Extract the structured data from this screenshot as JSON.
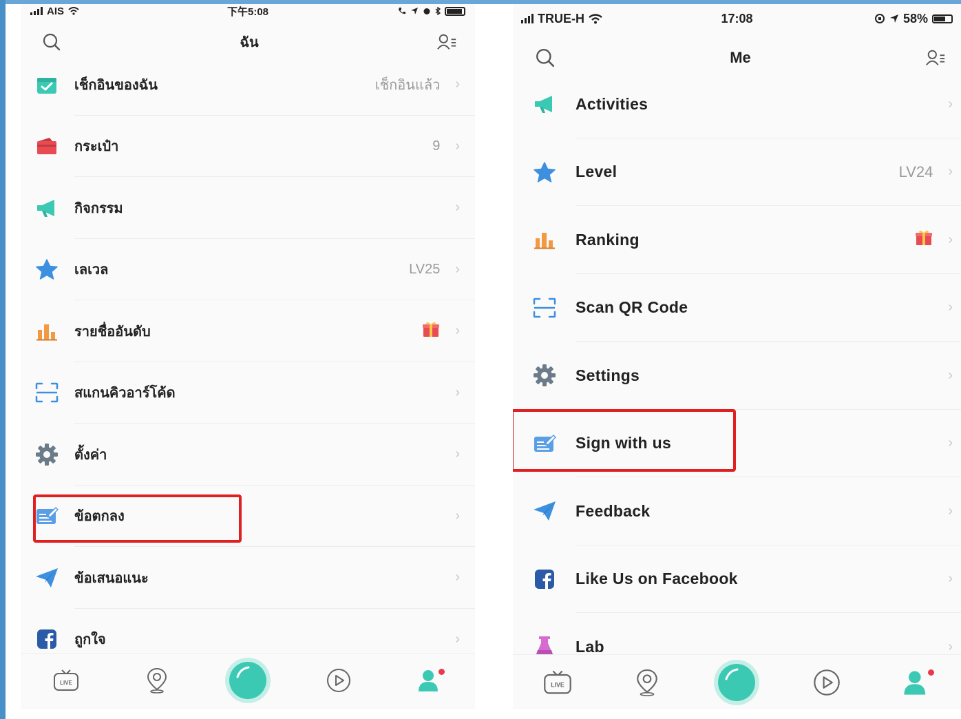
{
  "left_phone": {
    "status_bar": {
      "carrier": "AIS",
      "time": "下午5:08"
    },
    "title": "ฉัน",
    "menu": [
      {
        "label": "เช็กอินของฉัน",
        "value": "เช็กอินแล้ว",
        "icon": "calendar-check-icon"
      },
      {
        "label": "กระเป๋า",
        "value": "9",
        "icon": "wallet-icon"
      },
      {
        "label": "กิจกรรม",
        "value": "",
        "icon": "megaphone-icon"
      },
      {
        "label": "เลเวล",
        "value": "LV25",
        "icon": "star-icon"
      },
      {
        "label": "รายชื่ออันดับ",
        "value": "",
        "icon": "ranking-bars-icon"
      },
      {
        "label": "สแกนคิวอาร์โค้ด",
        "value": "",
        "icon": "qr-scan-icon"
      },
      {
        "label": "ตั้งค่า",
        "value": "",
        "icon": "gear-icon"
      },
      {
        "label": "ข้อตกลง",
        "value": "",
        "icon": "sign-agreement-icon"
      },
      {
        "label": "ข้อเสนอแนะ",
        "value": "",
        "icon": "paper-plane-icon"
      },
      {
        "label": "ถูกใจ",
        "value": "",
        "icon": "facebook-icon"
      }
    ]
  },
  "right_phone": {
    "status_bar": {
      "carrier": "TRUE-H",
      "time": "17:08",
      "battery": "58%"
    },
    "title": "Me",
    "menu": [
      {
        "label": "Activities",
        "value": "",
        "icon": "megaphone-icon"
      },
      {
        "label": "Level",
        "value": "LV24",
        "icon": "star-icon"
      },
      {
        "label": "Ranking",
        "value": "",
        "icon": "ranking-bars-icon"
      },
      {
        "label": "Scan QR Code",
        "value": "",
        "icon": "qr-scan-icon"
      },
      {
        "label": "Settings",
        "value": "",
        "icon": "gear-icon"
      },
      {
        "label": "Sign with us",
        "value": "",
        "icon": "sign-agreement-icon"
      },
      {
        "label": "Feedback",
        "value": "",
        "icon": "paper-plane-icon"
      },
      {
        "label": "Like Us on Facebook",
        "value": "",
        "icon": "facebook-icon"
      },
      {
        "label": "Lab",
        "value": "",
        "icon": "flask-icon"
      }
    ]
  },
  "tab_bar": {
    "live_label": "LIVE"
  },
  "colors": {
    "teal": "#3cc9b4",
    "red": "#e84b52",
    "blue": "#3d8fe0",
    "orange": "#f29a43",
    "gray": "#6c7b8a",
    "purple": "#d76bd0",
    "facebook": "#2b5aa6",
    "highlight": "#e02020"
  }
}
